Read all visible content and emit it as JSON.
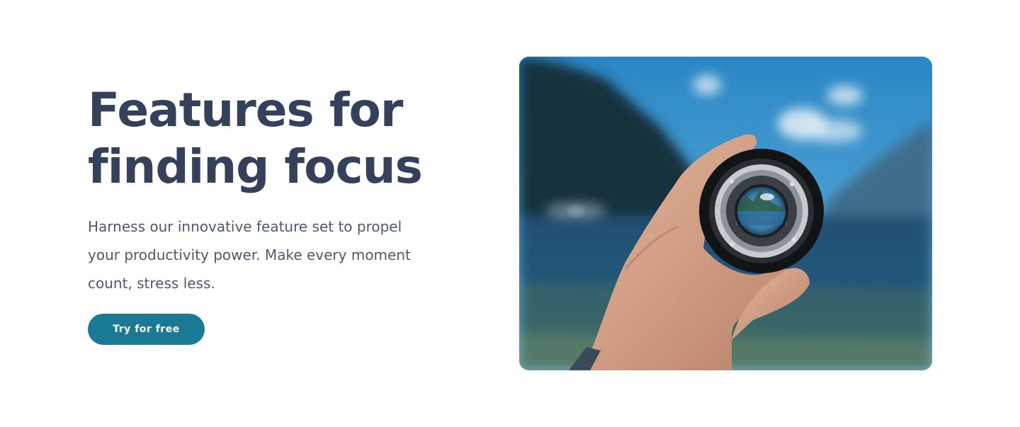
{
  "hero": {
    "title_line1": "Features for",
    "title_line2": "finding focus",
    "subtitle": "Harness our innovative feature set to propel your productivity power. Make every moment count, stress less.",
    "cta_label": "Try for free"
  },
  "image": {
    "description_icon": "hand-holding-lens-photo"
  },
  "colors": {
    "heading": "#33425a",
    "body": "#4e596d",
    "accent": "#1a7a96"
  }
}
